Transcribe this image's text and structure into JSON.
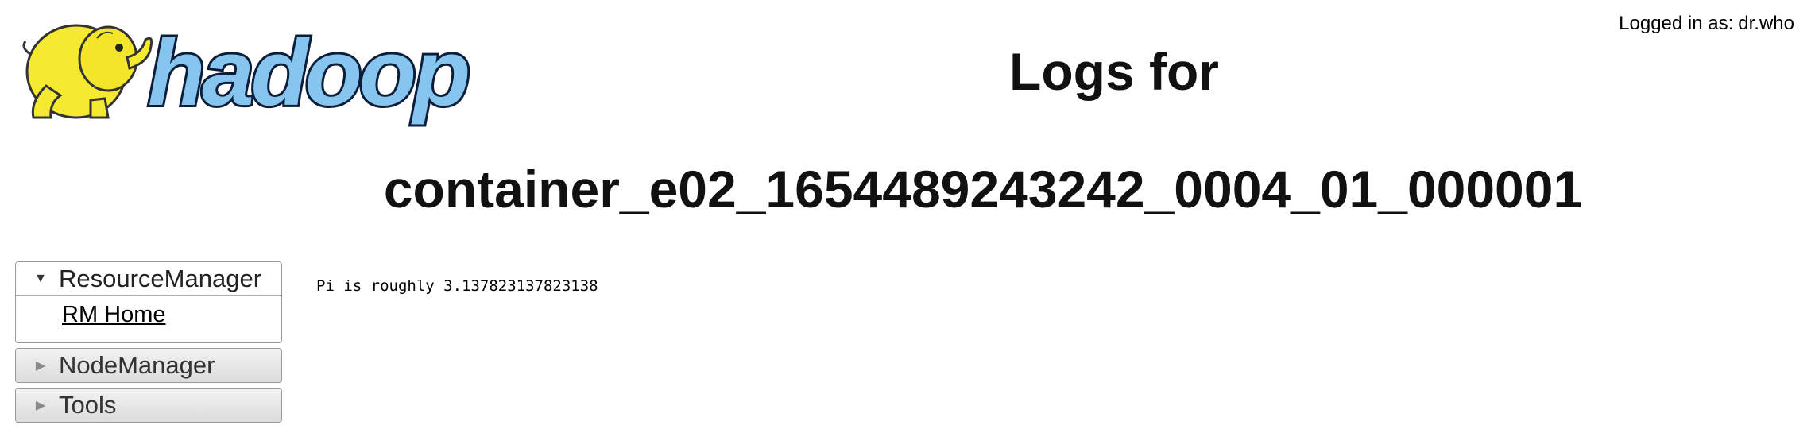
{
  "header": {
    "logo_alt": "hadoop",
    "logged_in_prefix": "Logged in as:",
    "logged_in_user": "dr.who",
    "title_line1": "Logs for",
    "title_line2": "container_e02_1654489243242_0004_01_000001"
  },
  "nav": {
    "sections": [
      {
        "label": "ResourceManager",
        "expanded": true,
        "arrow": "▼",
        "links": [
          {
            "label": "RM Home"
          }
        ]
      },
      {
        "label": "NodeManager",
        "expanded": false,
        "arrow": "▶"
      },
      {
        "label": "Tools",
        "expanded": false,
        "arrow": "▶"
      }
    ]
  },
  "content": {
    "log_text": "Pi is roughly 3.137823137823138"
  },
  "colors": {
    "logo_text_fill": "#86c6ee",
    "logo_text_stroke": "#0b1d3a",
    "elephant_yellow": "#f5ea2f"
  }
}
